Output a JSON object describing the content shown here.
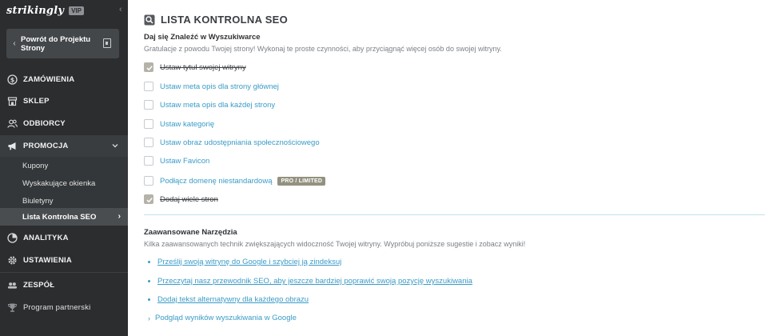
{
  "sidebar": {
    "brand": "strikingly",
    "plan_badge": "VIP",
    "back_label": "Powrót do Projektu Strony",
    "nav": [
      {
        "label": "ZAMÓWIENIA",
        "icon": "dollar-icon"
      },
      {
        "label": "SKLEP",
        "icon": "store-icon"
      },
      {
        "label": "ODBIORCY",
        "icon": "people-icon"
      },
      {
        "label": "PROMOCJA",
        "icon": "megaphone-icon"
      },
      {
        "label": "ANALITYKA",
        "icon": "chart-icon"
      },
      {
        "label": "USTAWIENIA",
        "icon": "gear-icon"
      },
      {
        "label": "ZESPÓŁ",
        "icon": "team-icon"
      },
      {
        "label": "Program partnerski",
        "icon": "trophy-icon"
      }
    ],
    "promo_sub": [
      "Kupony",
      "Wyskakujące okienka",
      "Biuletyny",
      "Lista Kontrolna SEO"
    ]
  },
  "main": {
    "title": "LISTA KONTROLNA SEO",
    "section1": {
      "heading": "Daj się Znaleźć w Wyszukiwarce",
      "desc": "Gratulacje z powodu Twojej strony! Wykonaj te proste czynności, aby przyciągnąć więcej osób do swojej witryny.",
      "items": [
        {
          "label": "Ustaw tytuł swojej witryny",
          "done": true
        },
        {
          "label": "Ustaw meta opis dla strony głównej",
          "done": false
        },
        {
          "label": "Ustaw meta opis dla każdej strony",
          "done": false
        },
        {
          "label": "Ustaw kategorię",
          "done": false
        },
        {
          "label": "Ustaw obraz udostępniania społecznościowego",
          "done": false
        },
        {
          "label": "Ustaw Favicon",
          "done": false
        },
        {
          "label": "Podłącz domenę niestandardową",
          "done": false,
          "badge": "PRO / LIMITED"
        },
        {
          "label": "Dodaj wiele stron",
          "done": true
        }
      ]
    },
    "section2": {
      "heading": "Zaawansowane Narzędzia",
      "desc": "Kilka zaawansowanych technik zwiększających widoczność Twojej witryny. Wypróbuj poniższe sugestie i zobacz wyniki!",
      "links": [
        "Prześlij swoją witrynę do Google i szybciej ją zindeksuj",
        "Przeczytaj nasz przewodnik SEO, aby jeszcze bardziej poprawić swoją pozycję wyszukiwania",
        "Dodaj tekst alternatywny dla każdego obrazu"
      ],
      "preview_link": "Podgląd wyników wyszukiwania w Google"
    }
  },
  "colors": {
    "sidebar_bg": "#2b2d2f",
    "link": "#3a9bc7",
    "badge_bg": "#93917f"
  }
}
